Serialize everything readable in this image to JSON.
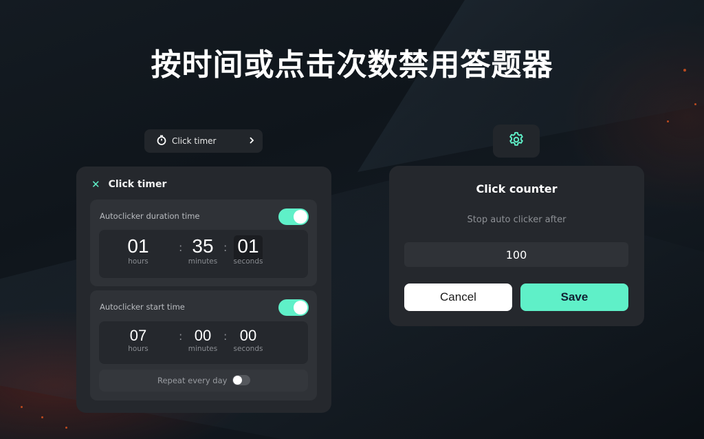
{
  "headline": "按时间或点击次数禁用答题器",
  "pill": {
    "label": "Click timer",
    "icon": "stopwatch-icon",
    "chevron": "›"
  },
  "settings_button": {
    "icon": "gear-icon"
  },
  "click_timer_panel": {
    "title": "Click timer",
    "close_glyph": "✕",
    "duration": {
      "label": "Autoclicker duration time",
      "enabled": true,
      "hours": "01",
      "minutes": "35",
      "seconds": "01",
      "unit_hours": "hours",
      "unit_minutes": "minutes",
      "unit_seconds": "seconds"
    },
    "start": {
      "label": "Autoclicker start time",
      "enabled": true,
      "hours": "07",
      "minutes": "00",
      "seconds": "00",
      "unit_hours": "hours",
      "unit_minutes": "minutes",
      "unit_seconds": "seconds",
      "repeat_label": "Repeat every day",
      "repeat_enabled": false
    }
  },
  "click_counter_dialog": {
    "title": "Click counter",
    "subtitle": "Stop auto clicker after",
    "value": "100",
    "cancel_label": "Cancel",
    "save_label": "Save"
  },
  "colors": {
    "accent": "#5ff0c8",
    "panel": "#25282d",
    "card": "#2f3237"
  }
}
